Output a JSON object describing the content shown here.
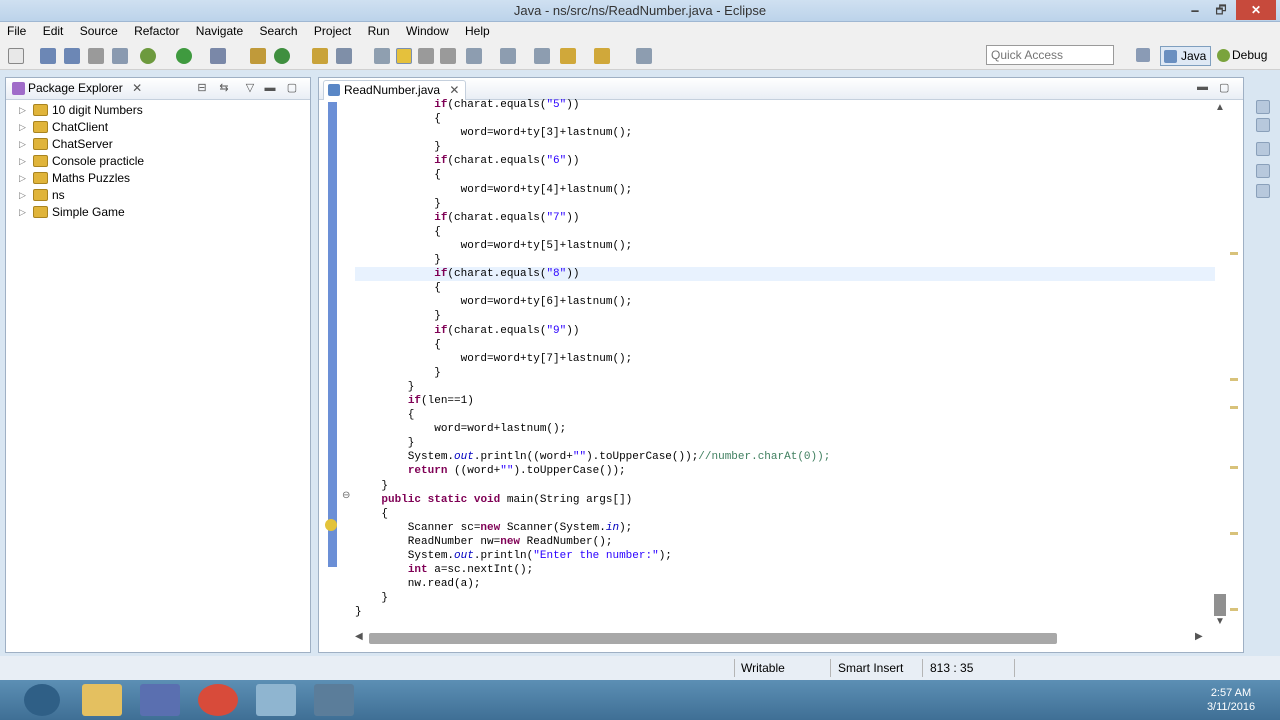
{
  "window": {
    "title": "Java - ns/src/ns/ReadNumber.java - Eclipse",
    "minimize": "🗕",
    "maximize": "🗗",
    "close": "✕"
  },
  "menu": [
    "File",
    "Edit",
    "Source",
    "Refactor",
    "Navigate",
    "Search",
    "Project",
    "Run",
    "Window",
    "Help"
  ],
  "toolbar": {
    "quick_access_placeholder": "Quick Access",
    "perspectives": [
      "Java",
      "Debug"
    ],
    "icons": [
      "new-icon",
      "save-icon",
      "save-all-icon",
      "print-icon",
      "debug-icon",
      "run-icon",
      "external-tools-icon",
      "new-java-project-icon",
      "new-package-icon",
      "new-class-icon",
      "open-type-icon",
      "search-icon",
      "toggle-mark-occurrences-icon",
      "next-annotation-icon",
      "prev-annotation-icon",
      "back-icon",
      "forward-icon",
      "pin-editor-icon"
    ]
  },
  "package_explorer": {
    "title": "Package Explorer",
    "close": "✕",
    "projects": [
      "10 digit Numbers",
      "ChatClient",
      "ChatServer",
      "Console practicle",
      "Maths Puzzles",
      "ns",
      "Simple Game"
    ]
  },
  "editor": {
    "tab_title": "ReadNumber.java",
    "tab_close": "✕",
    "current_line": 12,
    "code_lines": [
      "            if(charat.equals(\"5\"))",
      "            {",
      "                word=word+ty[3]+lastnum();",
      "            }",
      "            if(charat.equals(\"6\"))",
      "            {",
      "                word=word+ty[4]+lastnum();",
      "            }",
      "            if(charat.equals(\"7\"))",
      "            {",
      "                word=word+ty[5]+lastnum();",
      "            }",
      "            if(charat.equals(\"8\"))",
      "            {",
      "                word=word+ty[6]+lastnum();",
      "            }",
      "            if(charat.equals(\"9\"))",
      "            {",
      "                word=word+ty[7]+lastnum();",
      "            }",
      "        }",
      "        if(len==1)",
      "        {",
      "            word=word+lastnum();",
      "        }",
      "        System.out.println((word+\"\").toUpperCase());//number.charAt(0));",
      "        return ((word+\"\").toUpperCase());",
      "    }",
      "    public static void main(String args[])",
      "    {",
      "        Scanner sc=new Scanner(System.in);",
      "        ReadNumber nw=new ReadNumber();",
      "        System.out.println(\"Enter the number:\");",
      "        int a=sc.nextInt();",
      "        nw.read(a);",
      "    }",
      "}"
    ]
  },
  "status_bar": {
    "writable": "Writable",
    "insert_mode": "Smart Insert",
    "position": "813 : 35"
  },
  "taskbar": {
    "time": "2:57 AM",
    "date": "3/11/2016"
  },
  "colors": {
    "keyword": "#7f0055",
    "string": "#2a00ff",
    "comment": "#3f7f5f",
    "field": "#0000c0",
    "current_line": "#e8f2fe",
    "taskbar": "#4a7ba3"
  }
}
